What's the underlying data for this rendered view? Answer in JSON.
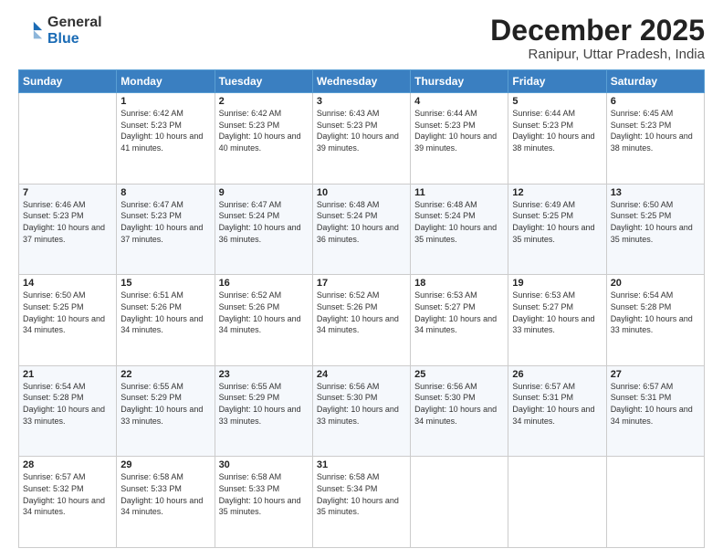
{
  "logo": {
    "general": "General",
    "blue": "Blue"
  },
  "title": "December 2025",
  "subtitle": "Ranipur, Uttar Pradesh, India",
  "days_of_week": [
    "Sunday",
    "Monday",
    "Tuesday",
    "Wednesday",
    "Thursday",
    "Friday",
    "Saturday"
  ],
  "weeks": [
    [
      {
        "day": "",
        "sunrise": "",
        "sunset": "",
        "daylight": ""
      },
      {
        "day": "1",
        "sunrise": "Sunrise: 6:42 AM",
        "sunset": "Sunset: 5:23 PM",
        "daylight": "Daylight: 10 hours and 41 minutes."
      },
      {
        "day": "2",
        "sunrise": "Sunrise: 6:42 AM",
        "sunset": "Sunset: 5:23 PM",
        "daylight": "Daylight: 10 hours and 40 minutes."
      },
      {
        "day": "3",
        "sunrise": "Sunrise: 6:43 AM",
        "sunset": "Sunset: 5:23 PM",
        "daylight": "Daylight: 10 hours and 39 minutes."
      },
      {
        "day": "4",
        "sunrise": "Sunrise: 6:44 AM",
        "sunset": "Sunset: 5:23 PM",
        "daylight": "Daylight: 10 hours and 39 minutes."
      },
      {
        "day": "5",
        "sunrise": "Sunrise: 6:44 AM",
        "sunset": "Sunset: 5:23 PM",
        "daylight": "Daylight: 10 hours and 38 minutes."
      },
      {
        "day": "6",
        "sunrise": "Sunrise: 6:45 AM",
        "sunset": "Sunset: 5:23 PM",
        "daylight": "Daylight: 10 hours and 38 minutes."
      }
    ],
    [
      {
        "day": "7",
        "sunrise": "Sunrise: 6:46 AM",
        "sunset": "Sunset: 5:23 PM",
        "daylight": "Daylight: 10 hours and 37 minutes."
      },
      {
        "day": "8",
        "sunrise": "Sunrise: 6:47 AM",
        "sunset": "Sunset: 5:23 PM",
        "daylight": "Daylight: 10 hours and 37 minutes."
      },
      {
        "day": "9",
        "sunrise": "Sunrise: 6:47 AM",
        "sunset": "Sunset: 5:24 PM",
        "daylight": "Daylight: 10 hours and 36 minutes."
      },
      {
        "day": "10",
        "sunrise": "Sunrise: 6:48 AM",
        "sunset": "Sunset: 5:24 PM",
        "daylight": "Daylight: 10 hours and 36 minutes."
      },
      {
        "day": "11",
        "sunrise": "Sunrise: 6:48 AM",
        "sunset": "Sunset: 5:24 PM",
        "daylight": "Daylight: 10 hours and 35 minutes."
      },
      {
        "day": "12",
        "sunrise": "Sunrise: 6:49 AM",
        "sunset": "Sunset: 5:25 PM",
        "daylight": "Daylight: 10 hours and 35 minutes."
      },
      {
        "day": "13",
        "sunrise": "Sunrise: 6:50 AM",
        "sunset": "Sunset: 5:25 PM",
        "daylight": "Daylight: 10 hours and 35 minutes."
      }
    ],
    [
      {
        "day": "14",
        "sunrise": "Sunrise: 6:50 AM",
        "sunset": "Sunset: 5:25 PM",
        "daylight": "Daylight: 10 hours and 34 minutes."
      },
      {
        "day": "15",
        "sunrise": "Sunrise: 6:51 AM",
        "sunset": "Sunset: 5:26 PM",
        "daylight": "Daylight: 10 hours and 34 minutes."
      },
      {
        "day": "16",
        "sunrise": "Sunrise: 6:52 AM",
        "sunset": "Sunset: 5:26 PM",
        "daylight": "Daylight: 10 hours and 34 minutes."
      },
      {
        "day": "17",
        "sunrise": "Sunrise: 6:52 AM",
        "sunset": "Sunset: 5:26 PM",
        "daylight": "Daylight: 10 hours and 34 minutes."
      },
      {
        "day": "18",
        "sunrise": "Sunrise: 6:53 AM",
        "sunset": "Sunset: 5:27 PM",
        "daylight": "Daylight: 10 hours and 34 minutes."
      },
      {
        "day": "19",
        "sunrise": "Sunrise: 6:53 AM",
        "sunset": "Sunset: 5:27 PM",
        "daylight": "Daylight: 10 hours and 33 minutes."
      },
      {
        "day": "20",
        "sunrise": "Sunrise: 6:54 AM",
        "sunset": "Sunset: 5:28 PM",
        "daylight": "Daylight: 10 hours and 33 minutes."
      }
    ],
    [
      {
        "day": "21",
        "sunrise": "Sunrise: 6:54 AM",
        "sunset": "Sunset: 5:28 PM",
        "daylight": "Daylight: 10 hours and 33 minutes."
      },
      {
        "day": "22",
        "sunrise": "Sunrise: 6:55 AM",
        "sunset": "Sunset: 5:29 PM",
        "daylight": "Daylight: 10 hours and 33 minutes."
      },
      {
        "day": "23",
        "sunrise": "Sunrise: 6:55 AM",
        "sunset": "Sunset: 5:29 PM",
        "daylight": "Daylight: 10 hours and 33 minutes."
      },
      {
        "day": "24",
        "sunrise": "Sunrise: 6:56 AM",
        "sunset": "Sunset: 5:30 PM",
        "daylight": "Daylight: 10 hours and 33 minutes."
      },
      {
        "day": "25",
        "sunrise": "Sunrise: 6:56 AM",
        "sunset": "Sunset: 5:30 PM",
        "daylight": "Daylight: 10 hours and 34 minutes."
      },
      {
        "day": "26",
        "sunrise": "Sunrise: 6:57 AM",
        "sunset": "Sunset: 5:31 PM",
        "daylight": "Daylight: 10 hours and 34 minutes."
      },
      {
        "day": "27",
        "sunrise": "Sunrise: 6:57 AM",
        "sunset": "Sunset: 5:31 PM",
        "daylight": "Daylight: 10 hours and 34 minutes."
      }
    ],
    [
      {
        "day": "28",
        "sunrise": "Sunrise: 6:57 AM",
        "sunset": "Sunset: 5:32 PM",
        "daylight": "Daylight: 10 hours and 34 minutes."
      },
      {
        "day": "29",
        "sunrise": "Sunrise: 6:58 AM",
        "sunset": "Sunset: 5:33 PM",
        "daylight": "Daylight: 10 hours and 34 minutes."
      },
      {
        "day": "30",
        "sunrise": "Sunrise: 6:58 AM",
        "sunset": "Sunset: 5:33 PM",
        "daylight": "Daylight: 10 hours and 35 minutes."
      },
      {
        "day": "31",
        "sunrise": "Sunrise: 6:58 AM",
        "sunset": "Sunset: 5:34 PM",
        "daylight": "Daylight: 10 hours and 35 minutes."
      },
      {
        "day": "",
        "sunrise": "",
        "sunset": "",
        "daylight": ""
      },
      {
        "day": "",
        "sunrise": "",
        "sunset": "",
        "daylight": ""
      },
      {
        "day": "",
        "sunrise": "",
        "sunset": "",
        "daylight": ""
      }
    ]
  ],
  "accent_color": "#3a7fc1"
}
